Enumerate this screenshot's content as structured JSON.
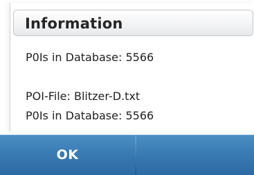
{
  "dialog": {
    "title": "Information",
    "lines": [
      "P0Is in Database: 5566",
      "POI-File: Blitzer-D.txt",
      "P0Is in Database: 5566"
    ]
  },
  "softkeys": {
    "left_label": "OK",
    "right_label": ""
  },
  "colors": {
    "softkey_bar": "#3a7bb4",
    "title_bar": "#f3f4f5",
    "text": "#222222"
  }
}
